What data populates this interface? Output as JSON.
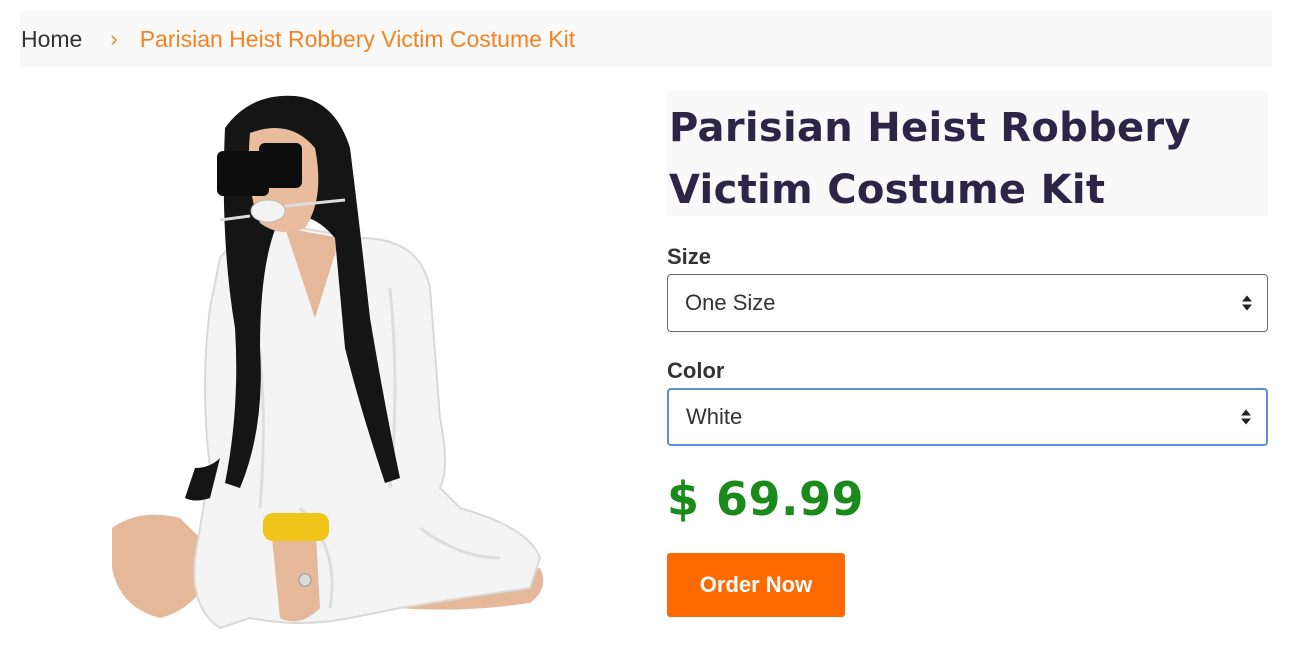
{
  "breadcrumb": {
    "home": "Home",
    "separator": "›",
    "current": "Parisian Heist Robbery Victim Costume Kit"
  },
  "product": {
    "title": "Parisian Heist Robbery Victim Costume Kit",
    "image_alt": "Costume kit model photo",
    "size_label": "Size",
    "size_value": "One Size",
    "color_label": "Color",
    "color_value": "White",
    "price": "$ 69.99",
    "order_button": "Order Now"
  },
  "colors": {
    "accent_orange": "#f58220",
    "button_orange": "#ff6a00",
    "price_green": "#1a8a1a",
    "title_navy": "#2c2547",
    "focus_blue": "#5b8fd6"
  }
}
